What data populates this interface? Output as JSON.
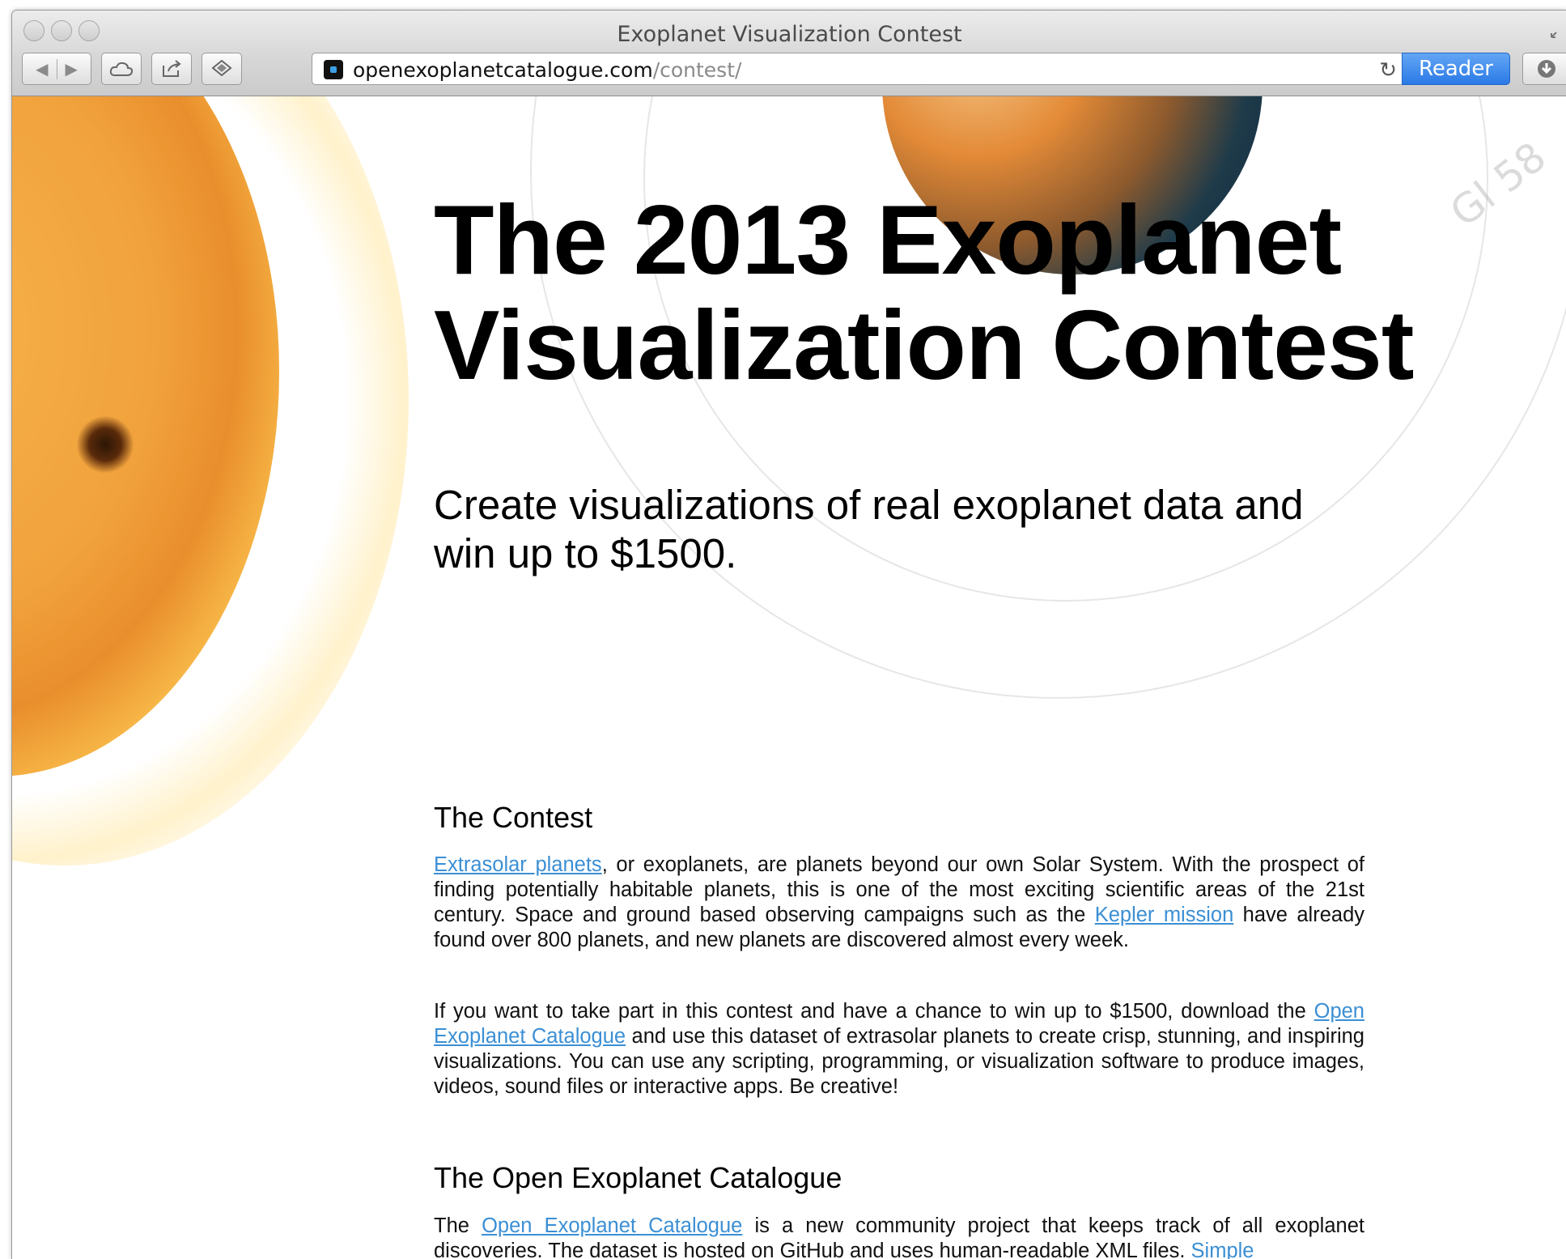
{
  "window": {
    "title": "Exoplanet Visualization Contest"
  },
  "toolbar": {
    "url_domain": "openexoplanetcatalogue.com",
    "url_path": "/contest/",
    "reader_label": "Reader"
  },
  "background": {
    "planet_label": "Gl 58"
  },
  "page": {
    "heading_line1": "The 2013 Exoplanet",
    "heading_line2": "Visualization Contest",
    "tagline": "Create visualizations of real exoplanet data and win up to $1500.",
    "sections": [
      {
        "title": "The Contest",
        "p1": {
          "link1": "Extrasolar planets",
          "text1": ", or exoplanets, are planets beyond our own Solar System. With the prospect of finding potentially habitable planets, this is one of the most exciting scientific areas of the 21st century. Space and ground based observing campaigns such as the ",
          "link2": "Kepler mission",
          "text2": " have already found over 800 planets, and new planets are discovered almost every week."
        },
        "p2": {
          "text1": "If you want to take part in this contest and have a chance to win up to $1500, download the ",
          "link1": "Open Exoplanet Catalogue",
          "text2": " and use this dataset of extrasolar planets to create crisp, stunning, and inspiring visualizations. You can use any scripting, programming, or visualization software to produce images, videos, sound files or interactive apps. Be creative!"
        }
      },
      {
        "title": "The Open Exoplanet Catalogue",
        "p1": {
          "text1": "The ",
          "link1": "Open Exoplanet Catalogue",
          "text2": " is a new community project that keeps track of all exoplanet discoveries. The dataset is hosted on GitHub and uses human-readable XML files. ",
          "link2": "Simple"
        }
      }
    ]
  },
  "colors": {
    "link": "#3b8fd4",
    "reader_button": "#2a79e6"
  }
}
